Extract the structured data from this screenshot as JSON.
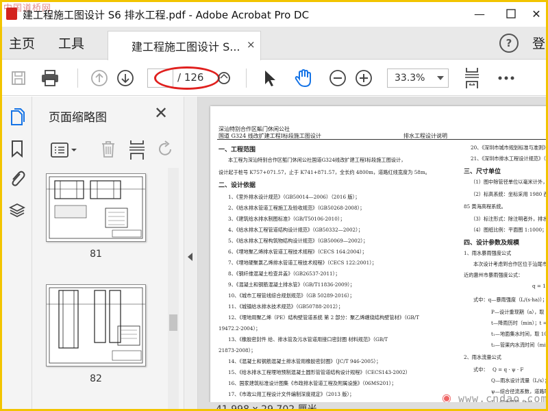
{
  "window": {
    "title": "建工程施工图设计 S6 排水工程.pdf - Adobe Acrobat Pro DC",
    "watermark": "中国道桥网",
    "min_label": "—",
    "max_label": "☐",
    "close_label": "✕"
  },
  "tabs": {
    "home": "主页",
    "tools": "工具",
    "document": "建工程施工图设计 S...",
    "doc_close": "×",
    "help": "?",
    "signin": "登"
  },
  "toolbar": {
    "page_current": "",
    "page_total": "/ 126",
    "zoom": "33.3%"
  },
  "panel": {
    "title": "页面缩略图",
    "close": "✕",
    "thumbnails": [
      {
        "page": "81"
      },
      {
        "page": "82"
      }
    ]
  },
  "document": {
    "header_left_1": "深汕特别合作区鲘门休闲公社",
    "header_left_2": "国道 G324 线改扩建工程Ⅰ标段施工图设计",
    "header_right": "排水工程设计说明",
    "sections": [
      "一、工程范围",
      "本工程为深汕特别合作区鲘门休闲公社国道G324线改扩建工程Ⅰ标段施工图设计，",
      "设计起于桩号 K757+071.57，止于 K741+871.57，全长约 4800m，道路红线宽度为 58m。",
      "二、设计依据",
      "1、《室外排水设计规范》（GB50014—2006）（2016 版）；",
      "2、《给水排水管道工程施工及验收规范》（GB50268-2008）；",
      "3、《建筑给水排水制图标准》（GB/T50106-2010）；",
      "4、《给水排水工程管道结构设计规范》（GB50332—2002）；",
      "5、《给水排水工程构筑物结构设计规范》（GB50069—2002）；",
      "6、《埋地聚乙烯排水管道工程技术规程》（CECS 164:2004）；",
      "7、《埋地硬聚氯乙烯排水管道工程技术规程》（CECS 122:2001）；",
      "8、《钢纤维混凝土检查井盖》（GB26537-2011）；",
      "9、《混凝土和钢筋混凝土排水管》（GB/T11836-2009）；",
      "10、《城市工程管线综合规划规范》（GB 50289-2016）；",
      "11、《城镇给水排水技术规范》（GB50788-2012）；",
      "12、《埋地用聚乙烯（PE）结构壁管道系统 第 2 部分：聚乙烯缠绕结构壁管材》（GB/T",
      "19472.2-2004）；",
      "13、《橡胶密封件 给、排水管及污水管道用接口密封圈 材料规范》（GB/T",
      "21873-2008）；",
      "14、《混凝土和钢筋混凝土排水管用橡胶密封圈》（JC/T 946-2005）；",
      "15、《给水排水工程埋地预制混凝土圆形管管道结构设计规程》（CECS143-2002）",
      "16、国家建筑标准设计图集《市政排水管道工程及附属设施》（06MS201）；",
      "17、《市政公用工程设计文件编制深度规定》（2013 版）；"
    ],
    "right_col": [
      "20、《深圳市城市规划标准与准则》（2",
      "21、《深圳市排水工程设计规范》（",
      "三、尺寸单位",
      "（1）图中除管径单位以毫米计外，其",
      "（2）标高系统：坐标采用 1980 西安",
      "85 黄海高程系统。",
      "（3）标注形式：除注明者外，排水管",
      "（4）图纸比例：平面图 1:1000；纵断",
      "四、设计参数及规模",
      "1、雨水暴雨强度公式",
      "本次设计考虑到合作区位于汕尾市四",
      "近的惠州市暴雨强度公式：",
      "式中：q—暴雨强度（L/(s·ha)）；",
      "P—设计重现期（a），取 3 年。",
      "t—降雨历时（min）；t = t₁ + t₂",
      "t₁—地面集水时间，取 10min；",
      "t₂—管渠内水流时间（min）。",
      "2、雨水流量公式",
      "Q—雨水设计流量（L/s）；",
      "ψ—综合径流系数，道路取 0.",
      "F—汇水面积（ha）"
    ],
    "formula_1": "q = 1337.74",
    "formula_2": "Q = q · ψ · F",
    "formula_2_label": "式中：",
    "dimensions": "41.998 x 29.702 厘米",
    "watermark": "www.cndao.com"
  }
}
